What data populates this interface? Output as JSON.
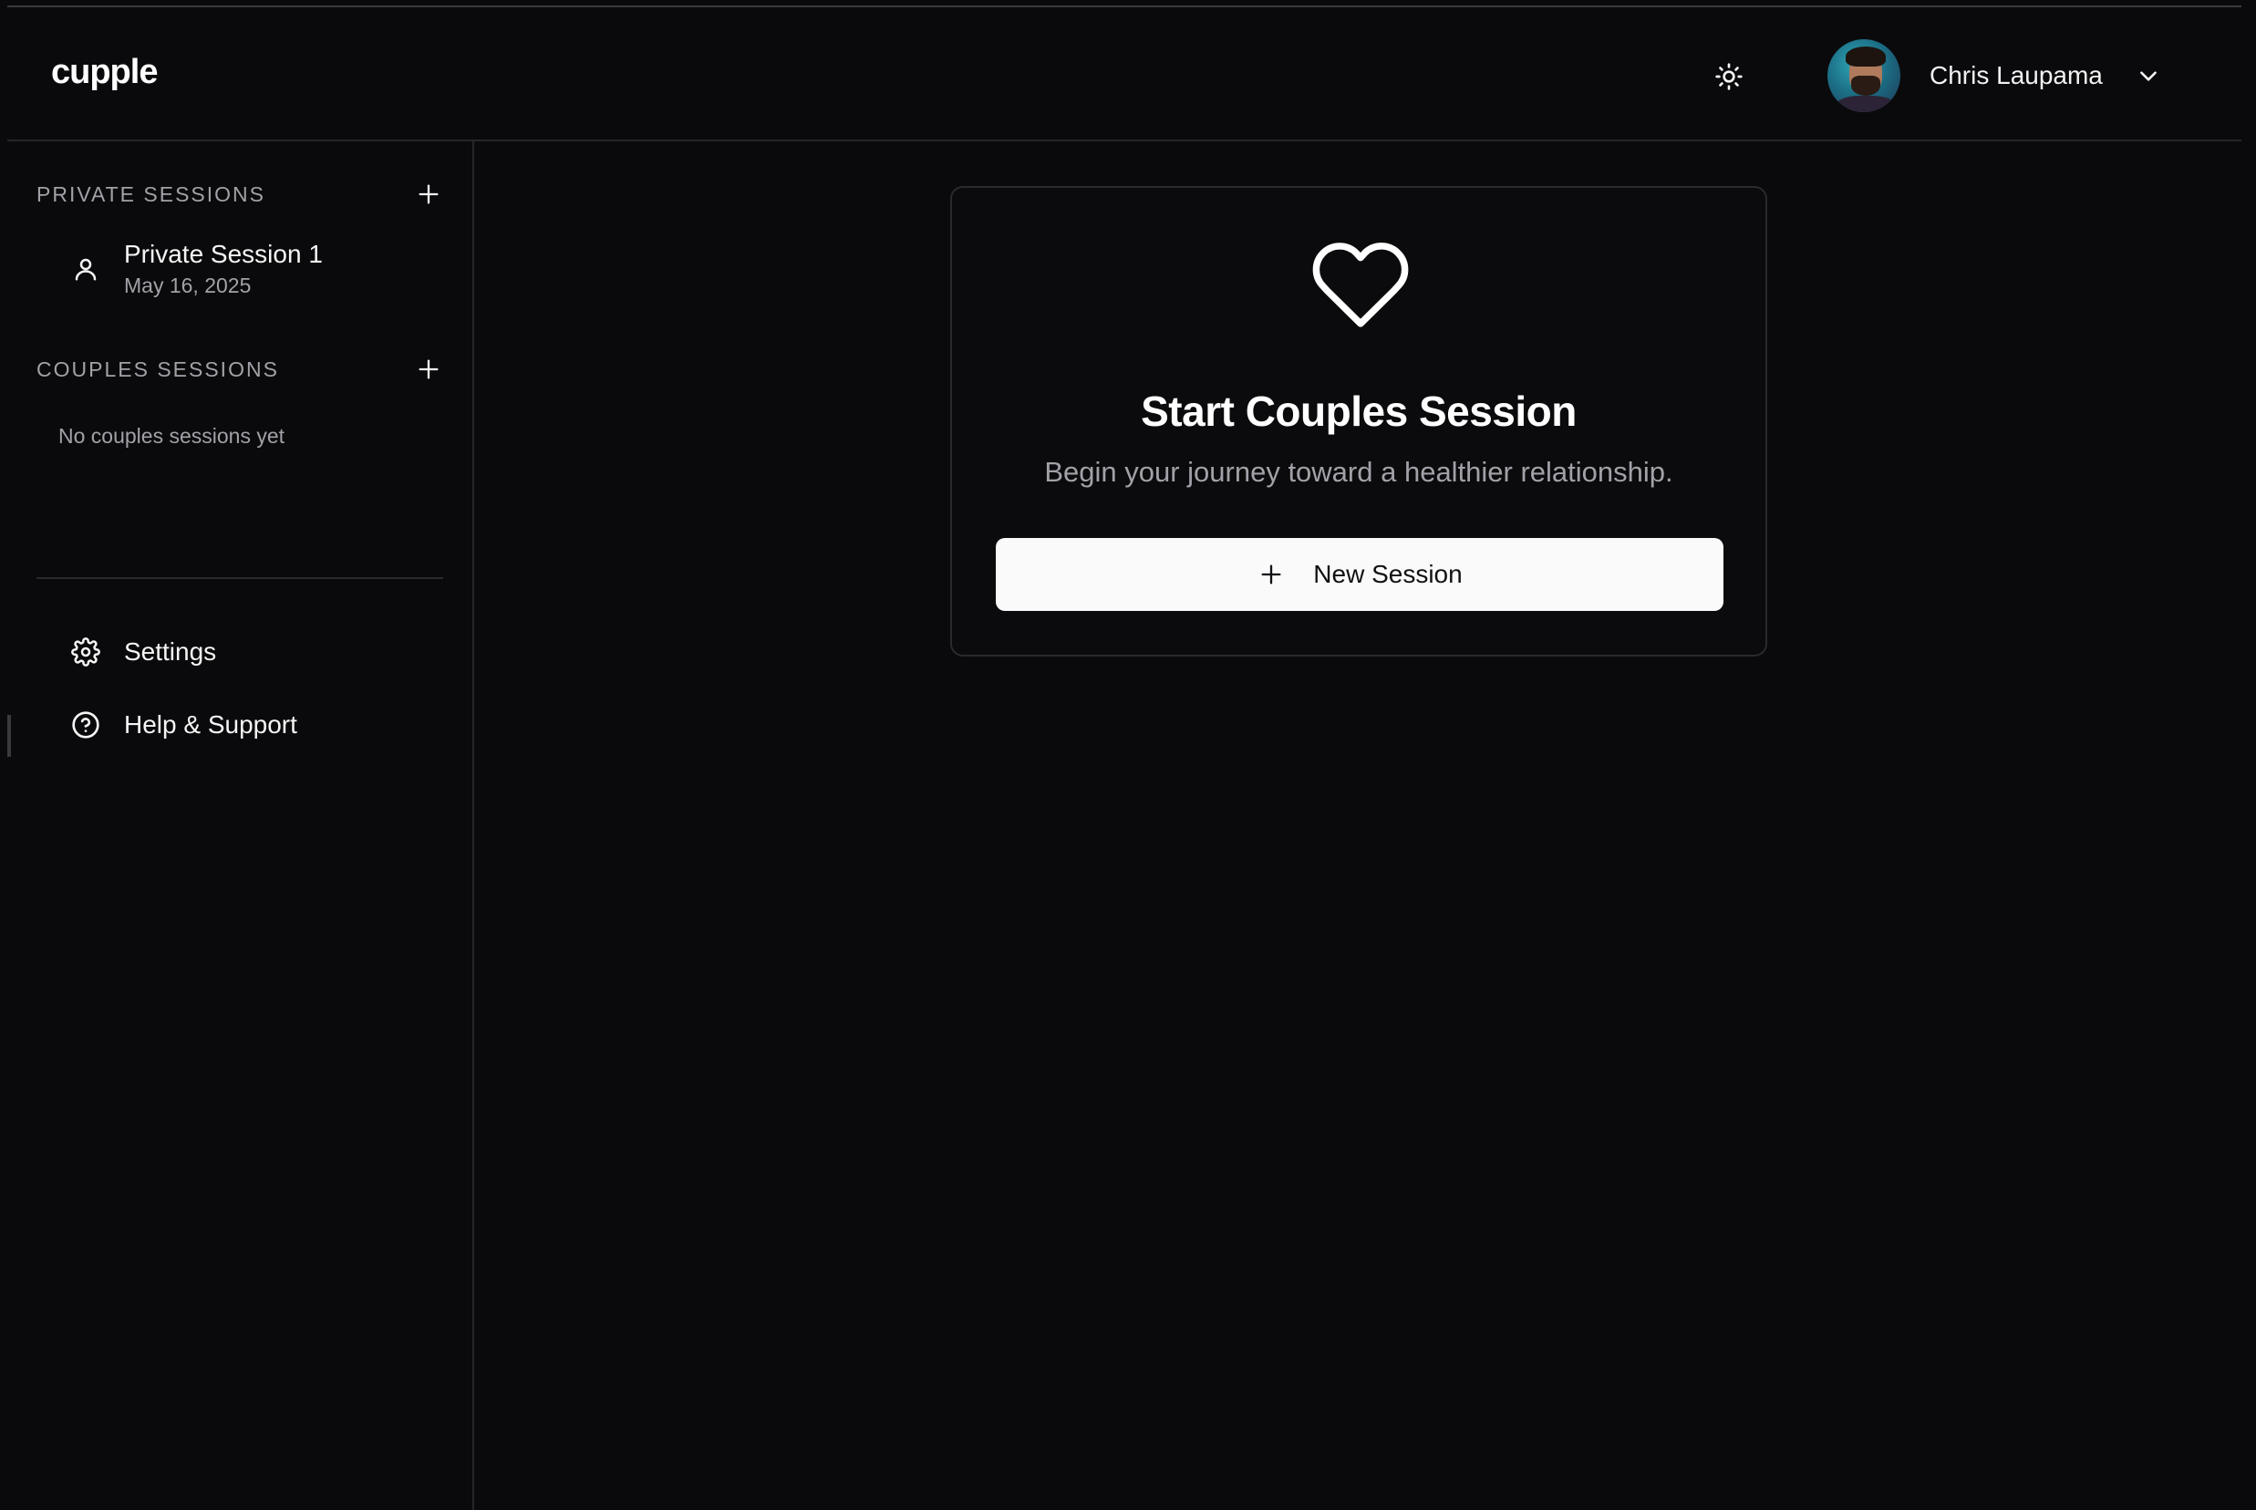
{
  "header": {
    "logo": "cupple",
    "user_name": "Chris Laupama",
    "theme_icon": "sun-icon",
    "menu_icon": "chevron-down-icon"
  },
  "sidebar": {
    "private": {
      "title": "PRIVATE SESSIONS",
      "add_icon": "plus-icon",
      "items": [
        {
          "title": "Private Session 1",
          "date": "May 16, 2025",
          "icon": "user-icon"
        }
      ]
    },
    "couples": {
      "title": "COUPLES SESSIONS",
      "add_icon": "plus-icon",
      "empty_text": "No couples sessions yet"
    },
    "nav": [
      {
        "label": "Settings",
        "icon": "gear-icon"
      },
      {
        "label": "Help & Support",
        "icon": "help-circle-icon"
      }
    ]
  },
  "main": {
    "card": {
      "icon": "heart-icon",
      "title": "Start Couples Session",
      "subtitle": "Begin your journey toward a healthier relationship.",
      "button_label": "New Session"
    }
  },
  "colors": {
    "background": "#0a0a0c",
    "border": "#26262a",
    "muted_text": "#a1a1a8",
    "button_bg": "#fafafa",
    "button_text": "#111114"
  }
}
